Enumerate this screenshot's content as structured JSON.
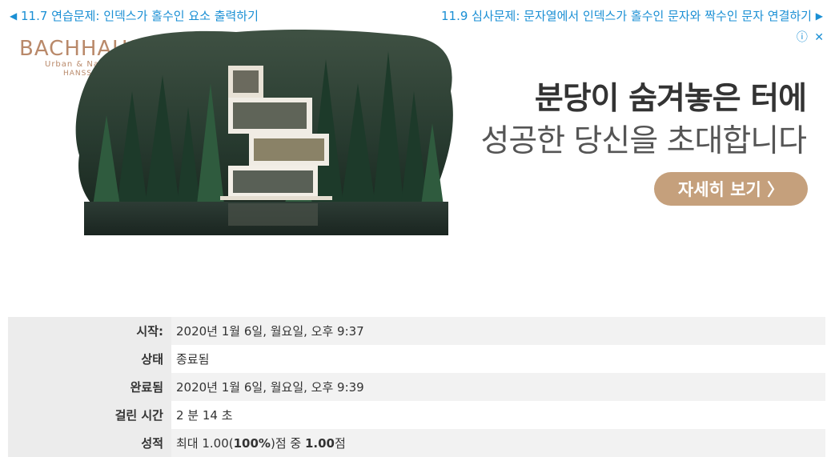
{
  "nav": {
    "prev_arrow": "◀",
    "prev_label": "11.7 연습문제: 인덱스가 홀수인 요소 출력하기",
    "next_label": "11.9 심사문제: 문자열에서 인덱스가 홀수인 문자와 짝수인 문자 연결하기",
    "next_arrow": "▶"
  },
  "ad": {
    "info_icon": "ⓘ",
    "close_icon": "✕",
    "logo_brand": "BACHHAUS",
    "logo_sub": "Urban & Nature",
    "logo_sub2": "HANSSEM",
    "headline1": "분당이 숨겨놓은 터에",
    "headline2": "성공한 당신을 초대합니다",
    "cta_label": "자세히 보기 〉",
    "colors": {
      "brand": "#b9896a",
      "cta": "#c5a07c"
    }
  },
  "summary": {
    "rows": [
      {
        "label": "시작:",
        "value": "2020년 1월 6일, 월요일, 오후 9:37"
      },
      {
        "label": "상태",
        "value": "종료됨"
      },
      {
        "label": "완료됨",
        "value": "2020년 1월 6일, 월요일, 오후 9:39"
      },
      {
        "label": "걸린 시간",
        "value": "2 분 14 초"
      }
    ],
    "grade_label": "성적",
    "grade_prefix": "최대 1.00(",
    "grade_percent": "100%",
    "grade_mid": ")점 중 ",
    "grade_score": "1.00",
    "grade_suffix": "점"
  }
}
